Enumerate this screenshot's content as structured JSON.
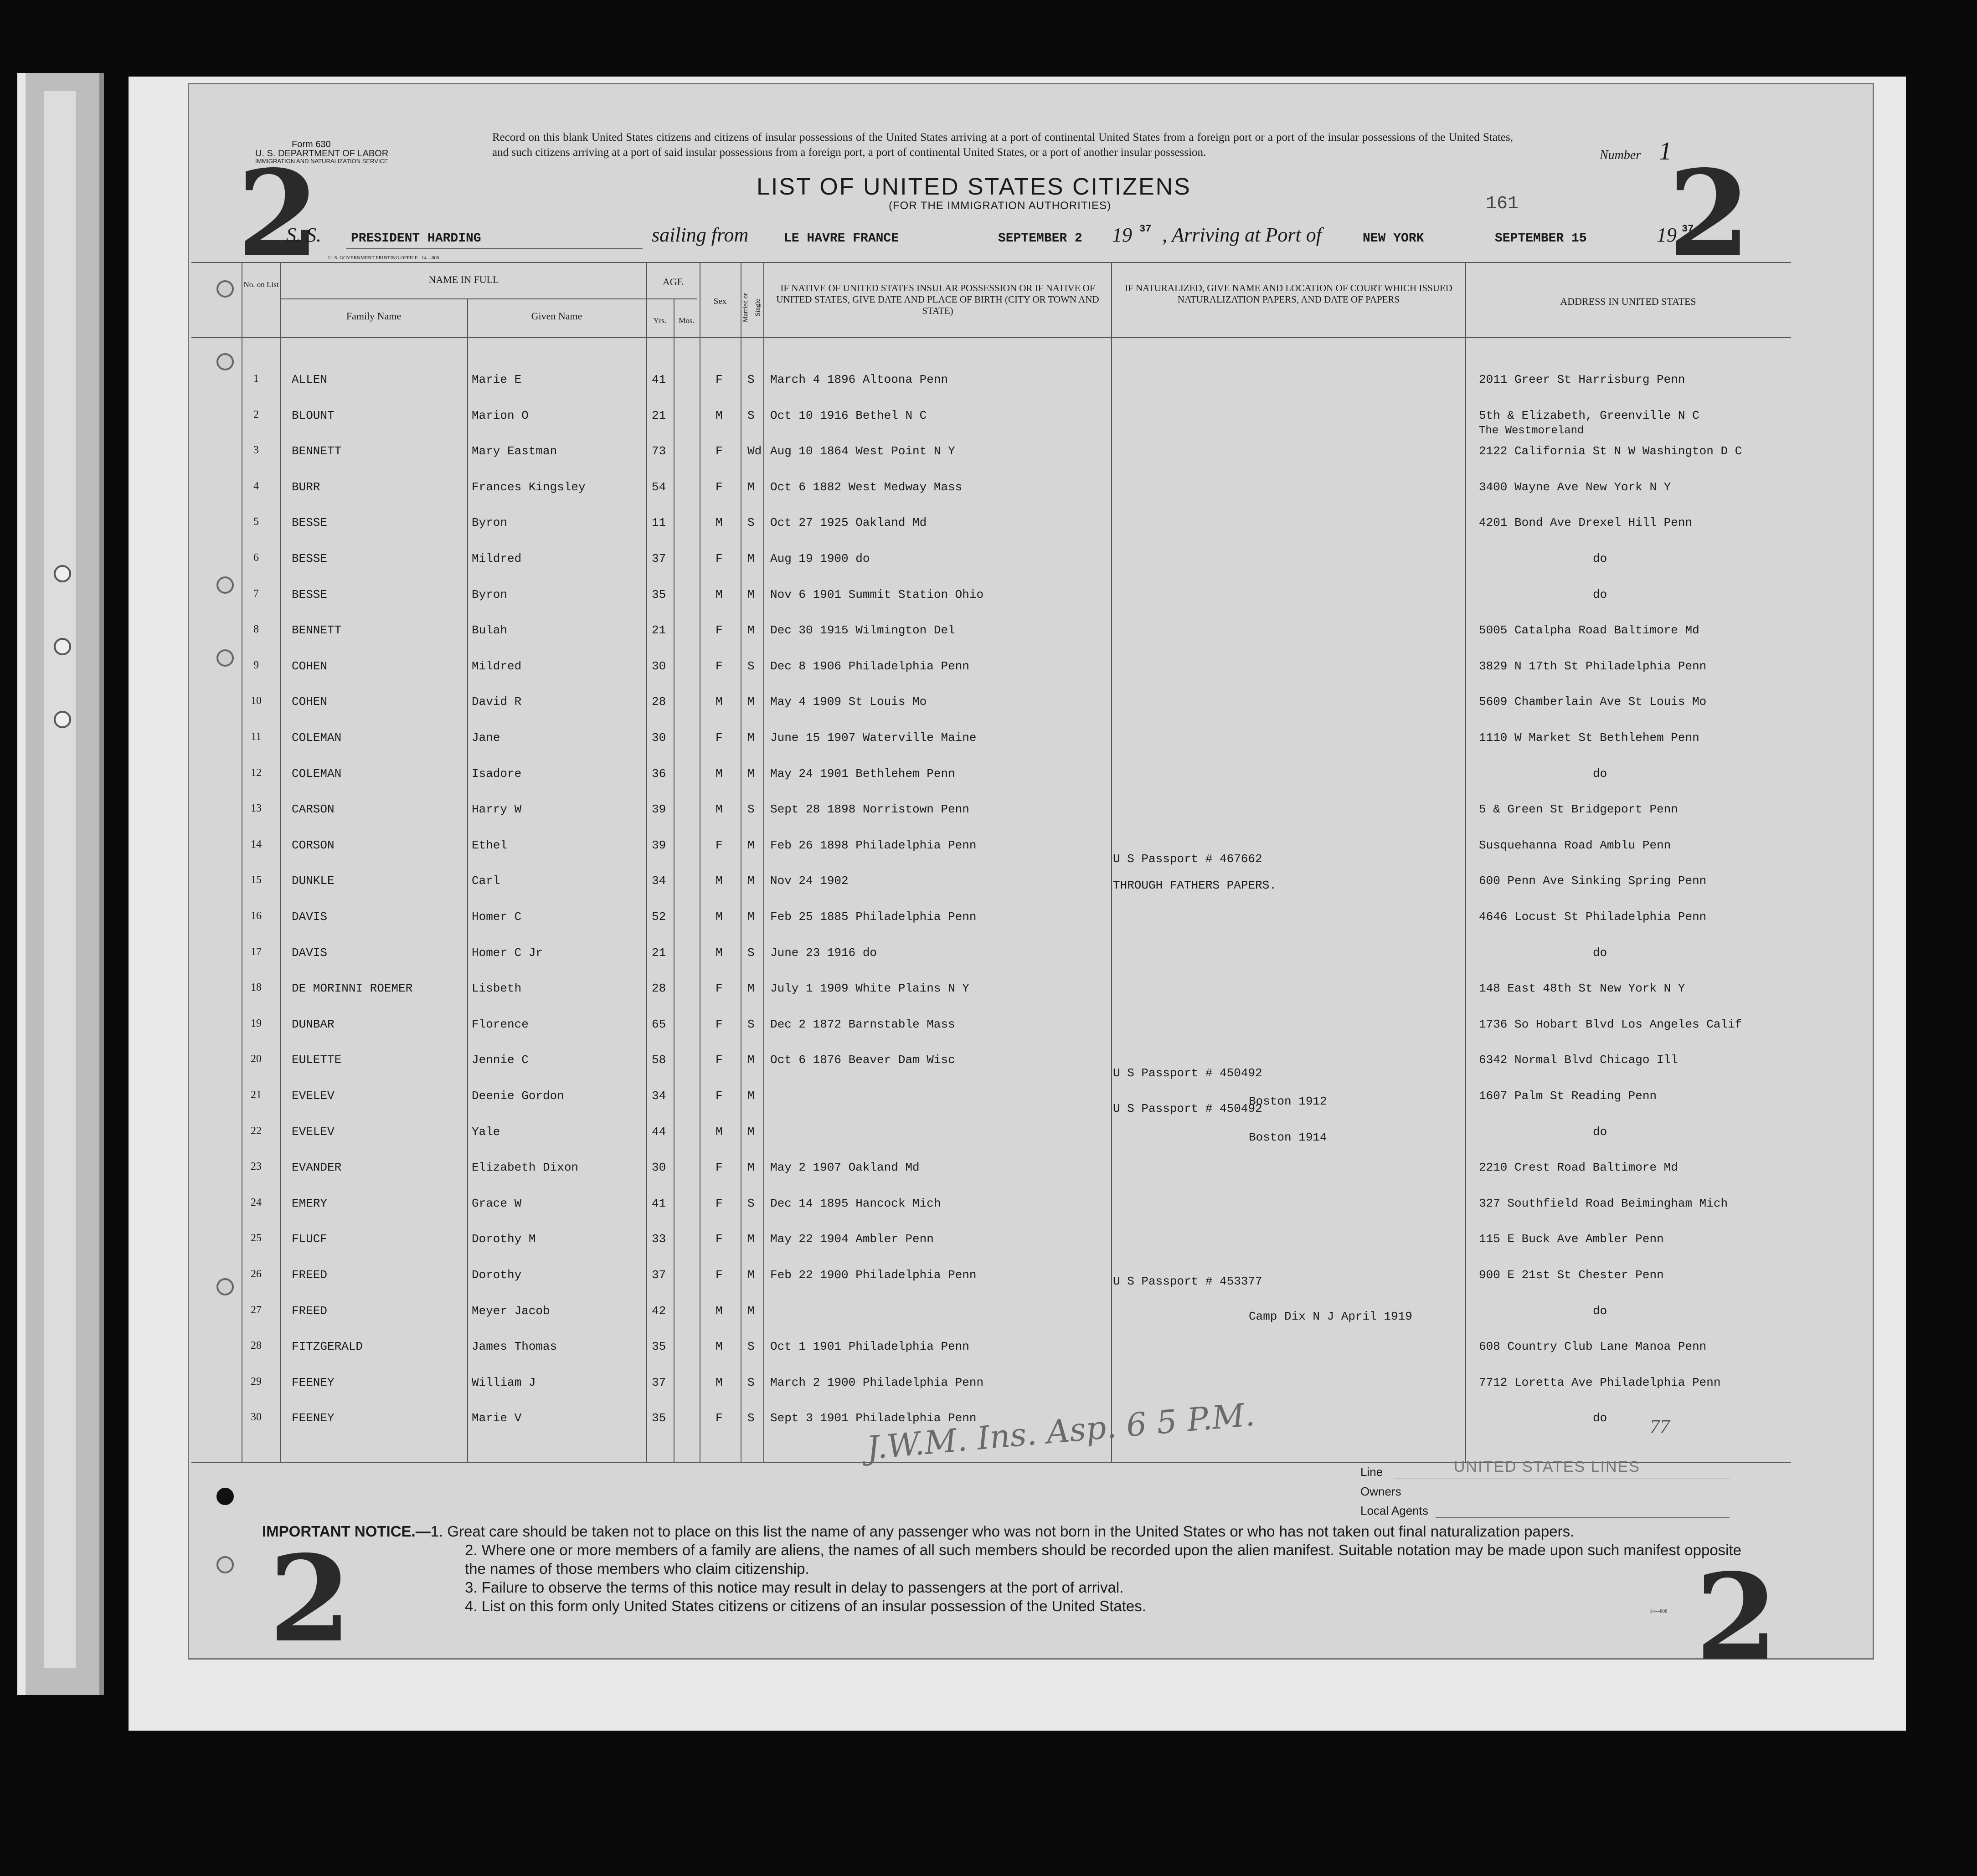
{
  "form": {
    "form_number": "Form 630",
    "department": "U. S. DEPARTMENT OF LABOR",
    "service": "IMMIGRATION AND NATURALIZATION SERVICE",
    "sheet_mark": "2",
    "intro": "Record on this blank United States citizens and citizens of insular possessions of the United States arriving at a port of continental United States from a foreign port or a port of the insular possessions of the United States, and such citizens arriving at a port of said insular possessions from a foreign port, a port of continental United States, or a port of another insular possession.",
    "title": "LIST OF UNITED STATES CITIZENS",
    "subtitle": "(FOR THE IMMIGRATION AUTHORITIES)",
    "number_label": "Number",
    "number_value": "1",
    "stamp_number": "161",
    "printer_line": "U. S. GOVERNMENT PRINTING OFFICE",
    "printer_code": "14—808",
    "corner_code": "14—808"
  },
  "voyage": {
    "ss_label": "S. S.",
    "ship": "PRESIDENT HARDING",
    "sailing_from_label": "sailing from",
    "port_from": "LE HAVRE   FRANCE",
    "date_from": "SEPTEMBER 2",
    "year_label_1": "19",
    "year_1": "37",
    "arriving_label": ", Arriving at Port of",
    "port_to": "NEW YORK",
    "date_to": "SEPTEMBER 15",
    "year_label_2": "19",
    "year_2": "37"
  },
  "headers": {
    "no_on_list": "No. on List",
    "name_in_full": "NAME IN FULL",
    "family_name": "Family Name",
    "given_name": "Given Name",
    "age": "AGE",
    "yrs": "Yrs.",
    "mos": "Mos.",
    "sex": "Sex",
    "married": "Married or Single",
    "birth": "IF NATIVE OF UNITED STATES INSULAR POSSESSION OR IF NATIVE OF UNITED STATES, GIVE DATE AND PLACE OF BIRTH (CITY OR TOWN AND STATE)",
    "naturalized": "IF NATURALIZED, GIVE NAME AND LOCATION OF COURT WHICH ISSUED NATURALIZATION PAPERS, AND DATE OF PAPERS",
    "address": "ADDRESS IN UNITED STATES"
  },
  "rows": [
    {
      "no": "1",
      "family": "ALLEN",
      "given": "Marie E",
      "yrs": "41",
      "sex": "F",
      "ms": "S",
      "birth": "March 4 1896 Altoona Penn",
      "nat": "",
      "address": "2011 Greer St Harrisburg Penn"
    },
    {
      "no": "2",
      "family": "BLOUNT",
      "given": "Marion O",
      "yrs": "21",
      "sex": "M",
      "ms": "S",
      "birth": "Oct 10 1916 Bethel N C",
      "nat": "",
      "address": "5th & Elizabeth, Greenville N C"
    },
    {
      "no": "3",
      "family": "BENNETT",
      "given": "Mary Eastman",
      "yrs": "73",
      "sex": "F",
      "ms": "Wd",
      "birth": "Aug 10 1864 West Point N Y",
      "nat": "",
      "address": "2122 California St N W Washington D C"
    },
    {
      "no": "4",
      "family": "BURR",
      "given": "Frances Kingsley",
      "yrs": "54",
      "sex": "F",
      "ms": "M",
      "birth": "Oct 6 1882 West Medway Mass",
      "nat": "",
      "address": "3400 Wayne Ave New York N Y"
    },
    {
      "no": "5",
      "family": "BESSE",
      "given": "Byron",
      "yrs": "11",
      "sex": "M",
      "ms": "S",
      "birth": "Oct 27 1925 Oakland Md",
      "nat": "",
      "address": "4201 Bond Ave Drexel Hill Penn"
    },
    {
      "no": "6",
      "family": "BESSE",
      "given": "Mildred",
      "yrs": "37",
      "sex": "F",
      "ms": "M",
      "birth": "Aug 19 1900      do",
      "nat": "",
      "address": "do"
    },
    {
      "no": "7",
      "family": "BESSE",
      "given": "Byron",
      "yrs": "35",
      "sex": "M",
      "ms": "M",
      "birth": "Nov 6 1901 Summit Station Ohio",
      "nat": "",
      "address": "do"
    },
    {
      "no": "8",
      "family": "BENNETT",
      "given": "Bulah",
      "yrs": "21",
      "sex": "F",
      "ms": "M",
      "birth": "Dec 30 1915 Wilmington Del",
      "nat": "",
      "address": "5005 Catalpha Road Baltimore Md"
    },
    {
      "no": "9",
      "family": "COHEN",
      "given": "Mildred",
      "yrs": "30",
      "sex": "F",
      "ms": "S",
      "birth": "Dec 8 1906 Philadelphia Penn",
      "nat": "",
      "address": "3829 N 17th St Philadelphia Penn"
    },
    {
      "no": "10",
      "family": "COHEN",
      "given": "David R",
      "yrs": "28",
      "sex": "M",
      "ms": "M",
      "birth": "May 4 1909 St Louis Mo",
      "nat": "",
      "address": "5609 Chamberlain Ave St Louis Mo"
    },
    {
      "no": "11",
      "family": "COLEMAN",
      "given": "Jane",
      "yrs": "30",
      "sex": "F",
      "ms": "M",
      "birth": "June 15 1907 Waterville Maine",
      "nat": "",
      "address": "1110 W Market St Bethlehem Penn"
    },
    {
      "no": "12",
      "family": "COLEMAN",
      "given": "Isadore",
      "yrs": "36",
      "sex": "M",
      "ms": "M",
      "birth": "May 24 1901 Bethlehem Penn",
      "nat": "",
      "address": "do"
    },
    {
      "no": "13",
      "family": "CARSON",
      "given": "Harry W",
      "yrs": "39",
      "sex": "M",
      "ms": "S",
      "birth": "Sept 28 1898 Norristown Penn",
      "nat": "",
      "address": "5 & Green St Bridgeport Penn"
    },
    {
      "no": "14",
      "family": "CORSON",
      "given": "Ethel",
      "yrs": "39",
      "sex": "F",
      "ms": "M",
      "birth": "Feb 26 1898 Philadelphia Penn",
      "nat": "",
      "address": "Susquehanna Road Amblu Penn"
    },
    {
      "no": "15",
      "family": "DUNKLE",
      "given": "Carl",
      "yrs": "34",
      "sex": "M",
      "ms": "M",
      "birth": "Nov 24 1902",
      "nat": "THROUGH FATHERS PAPERS.",
      "address": "600 Penn Ave Sinking Spring Penn"
    },
    {
      "no": "16",
      "family": "DAVIS",
      "given": "Homer C",
      "yrs": "52",
      "sex": "M",
      "ms": "M",
      "birth": "Feb 25 1885 Philadelphia Penn",
      "nat": "",
      "address": "4646 Locust St Philadelphia Penn"
    },
    {
      "no": "17",
      "family": "DAVIS",
      "given": "Homer C Jr",
      "yrs": "21",
      "sex": "M",
      "ms": "S",
      "birth": "June 23 1916       do",
      "nat": "",
      "address": "do"
    },
    {
      "no": "18",
      "family": "DE MORINNI ROEMER",
      "given": "Lisbeth",
      "yrs": "28",
      "sex": "F",
      "ms": "M",
      "birth": "July 1 1909 White Plains N Y",
      "nat": "",
      "address": "148 East 48th St New York N Y"
    },
    {
      "no": "19",
      "family": "DUNBAR",
      "given": "Florence",
      "yrs": "65",
      "sex": "F",
      "ms": "S",
      "birth": "Dec 2 1872 Barnstable Mass",
      "nat": "",
      "address": "1736 So Hobart Blvd Los Angeles Calif"
    },
    {
      "no": "20",
      "family": "EULETTE",
      "given": "Jennie C",
      "yrs": "58",
      "sex": "F",
      "ms": "M",
      "birth": "Oct 6 1876 Beaver Dam Wisc",
      "nat": "",
      "address": "6342 Normal Blvd Chicago Ill"
    },
    {
      "no": "21",
      "family": "EVELEV",
      "given": "Deenie Gordon",
      "yrs": "34",
      "sex": "F",
      "ms": "M",
      "birth": "",
      "nat": "Boston           1912",
      "address": "1607 Palm St Reading Penn"
    },
    {
      "no": "22",
      "family": "EVELEV",
      "given": "Yale",
      "yrs": "44",
      "sex": "M",
      "ms": "M",
      "birth": "",
      "nat": "Boston           1914",
      "address": "do"
    },
    {
      "no": "23",
      "family": "EVANDER",
      "given": "Elizabeth Dixon",
      "yrs": "30",
      "sex": "F",
      "ms": "M",
      "birth": "May 2 1907 Oakland Md",
      "nat": "",
      "address": "2210 Crest Road Baltimore Md"
    },
    {
      "no": "24",
      "family": "EMERY",
      "given": "Grace W",
      "yrs": "41",
      "sex": "F",
      "ms": "S",
      "birth": "Dec 14 1895 Hancock Mich",
      "nat": "",
      "address": "327 Southfield Road Beimingham Mich"
    },
    {
      "no": "25",
      "family": "FLUCF",
      "given": "Dorothy M",
      "yrs": "33",
      "sex": "F",
      "ms": "M",
      "birth": "May 22 1904 Ambler Penn",
      "nat": "",
      "address": "115 E Buck Ave Ambler Penn"
    },
    {
      "no": "26",
      "family": "FREED",
      "given": "Dorothy",
      "yrs": "37",
      "sex": "F",
      "ms": "M",
      "birth": "Feb 22 1900 Philadelphia Penn",
      "nat": "",
      "address": "900 E 21st St Chester Penn"
    },
    {
      "no": "27",
      "family": "FREED",
      "given": "Meyer Jacob",
      "yrs": "42",
      "sex": "M",
      "ms": "M",
      "birth": "",
      "nat": "Camp Dix N J   April     1919",
      "address": "do"
    },
    {
      "no": "28",
      "family": "FITZGERALD",
      "given": "James Thomas",
      "yrs": "35",
      "sex": "M",
      "ms": "S",
      "birth": "Oct 1 1901 Philadelphia Penn",
      "nat": "",
      "address": "608 Country Club Lane Manoa Penn"
    },
    {
      "no": "29",
      "family": "FEENEY",
      "given": "William J",
      "yrs": "37",
      "sex": "M",
      "ms": "S",
      "birth": "March 2 1900 Philadelphia Penn",
      "nat": "",
      "address": "7712 Loretta Ave Philadelphia Penn"
    },
    {
      "no": "30",
      "family": "FEENEY",
      "given": "Marie V",
      "yrs": "35",
      "sex": "F",
      "ms": "S",
      "birth": "Sept 3 1901 Philadelphia Penn",
      "nat": "",
      "address": "do"
    }
  ],
  "extra_lines": {
    "address_2b": "The Westmoreland",
    "nat_15": "U S Passport # 467662",
    "nat_21": "U S Passport # 450492",
    "nat_22": "U S Passport # 450492",
    "nat_27": "U S Passport # 453377"
  },
  "handwritten": {
    "signature": "J.W.M. Ins. Asp. 6 5 P.M.",
    "tally": "77"
  },
  "footer": {
    "line_label": "Line",
    "line_value": "UNITED STATES LINES",
    "owners_label": "Owners",
    "agents_label": "Local Agents",
    "notice_title": "IMPORTANT NOTICE.—",
    "notice_1": "1. Great care should be taken not to place on this list the name of any passenger who was not born in the United States or who has not taken out final naturalization papers.",
    "notice_2": "2. Where one or more members of a family are aliens, the names of all such members should be recorded upon the alien manifest. Suitable notation may be made upon such manifest opposite the names of those members who claim citizenship.",
    "notice_3": "3. Failure to observe the terms of this notice may result in delay to passengers at the port of arrival.",
    "notice_4": "4. List on this form only United States citizens or citizens of an insular possession of the United States."
  }
}
